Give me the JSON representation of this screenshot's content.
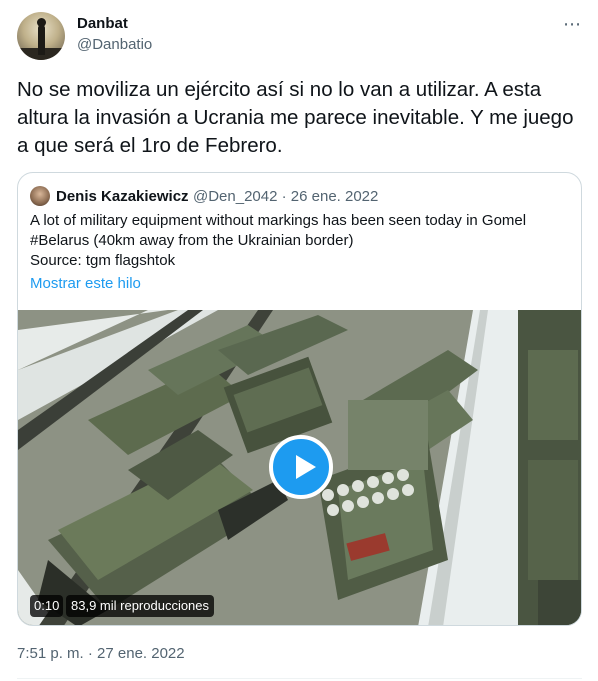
{
  "author": {
    "name": "Danbat",
    "handle": "@Danbatio",
    "avatar_icon": "avatar-silhouette"
  },
  "more_icon": "⋯",
  "tweet": {
    "text": "No se moviliza un ejército así si no lo van a utilizar. A esta altura la invasión a Ucrania me parece inevitable. Y me juego a que será el 1ro de Febrero.",
    "timestamp": "7:51 p. m. · 27 ene. 2022"
  },
  "quote": {
    "author_name": "Denis Kazakiewicz",
    "meta": "@Den_2042 · 26 ene. 2022",
    "lines": [
      "A lot of military equipment without markings has been seen today in Gomel",
      "#Belarus (40km away from the Ukrainian border)",
      "Source: tgm flagshtok"
    ],
    "show_thread": "Mostrar este hilo",
    "video": {
      "duration": "0:10",
      "views": "83,9 mil reproducciones"
    }
  },
  "colors": {
    "link": "#1d9bf0",
    "secondary_text": "#536471",
    "border": "#cfd9de"
  }
}
